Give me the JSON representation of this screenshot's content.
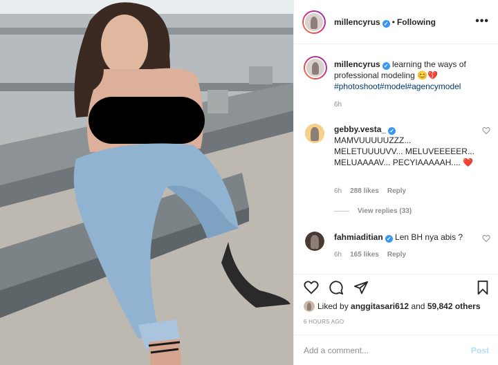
{
  "photo": {
    "alt_icon": "photo"
  },
  "header": {
    "username": "millencyrus",
    "follow_status": "Following",
    "more_label": "•••"
  },
  "caption": {
    "username": "millencyrus",
    "text": "learning the ways of professional modeling 😊💔",
    "hashtags": "#photoshoot#model#agencymodel",
    "time": "6h"
  },
  "comments": [
    {
      "username": "gebby.vesta_",
      "text": "MAMVUUUUUZZZ... MELETUUUUVV... MELUVEEEEER... MELUAAAAV... PECYIAAAAAH.... ❤️",
      "time": "6h",
      "likes": "288 likes",
      "reply": "Reply"
    },
    {
      "username": "fahmiaditian",
      "text": "Len BH nya abis ?",
      "time": "6h",
      "likes": "165 likes",
      "reply": "Reply"
    }
  ],
  "view_replies": "View replies (33)",
  "likes_line": {
    "prefix": "Liked by",
    "user": "anggitasari612",
    "and": "and",
    "count": "59,842 others"
  },
  "timestamp": "6 HOURS AGO",
  "add_comment": {
    "placeholder": "Add a comment...",
    "post_label": "Post"
  },
  "colors": {
    "verified": "#3897f0",
    "link": "#00376b",
    "muted": "#8e8e8e",
    "post_disabled": "#b2dffc"
  }
}
